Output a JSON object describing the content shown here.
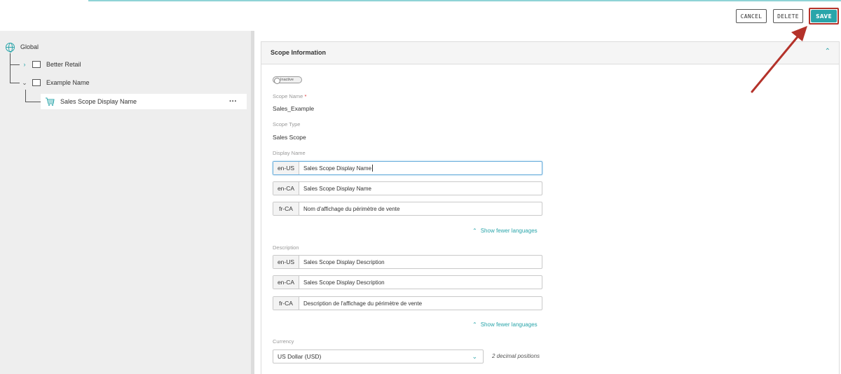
{
  "toolbar": {
    "cancel_label": "CANCEL",
    "delete_label": "DELETE",
    "save_label": "SAVE"
  },
  "tree": {
    "root_label": "Global",
    "items": [
      {
        "label": "Better Retail",
        "expanded": false
      },
      {
        "label": "Example Name",
        "expanded": true
      }
    ],
    "selected": {
      "label": "Sales Scope Display Name",
      "menu": "···"
    }
  },
  "card": {
    "title": "Scope Information",
    "status_toggle": "Inactive",
    "scope_name": {
      "label": "Scope Name",
      "required_mark": "*",
      "value": "Sales_Example"
    },
    "scope_type": {
      "label": "Scope Type",
      "value": "Sales Scope"
    },
    "display_name": {
      "label": "Display Name",
      "rows": [
        {
          "lang": "en-US",
          "value": "Sales Scope Display Name"
        },
        {
          "lang": "en-CA",
          "value": "Sales Scope Display Name"
        },
        {
          "lang": "fr-CA",
          "value": "Nom d'affichage du périmètre de vente"
        }
      ],
      "toggle_label": "Show fewer languages"
    },
    "description": {
      "label": "Description",
      "rows": [
        {
          "lang": "en-US",
          "value": "Sales Scope Display Description"
        },
        {
          "lang": "en-CA",
          "value": "Sales Scope Display Description"
        },
        {
          "lang": "fr-CA",
          "value": "Description de l'affichage du périmètre de vente"
        }
      ],
      "toggle_label": "Show fewer languages"
    },
    "currency": {
      "label": "Currency",
      "selected": "US Dollar (USD)",
      "decimal_note": "2 decimal positions"
    }
  },
  "colors": {
    "accent": "#2aa5aa",
    "annotation_arrow": "#b4322a"
  }
}
